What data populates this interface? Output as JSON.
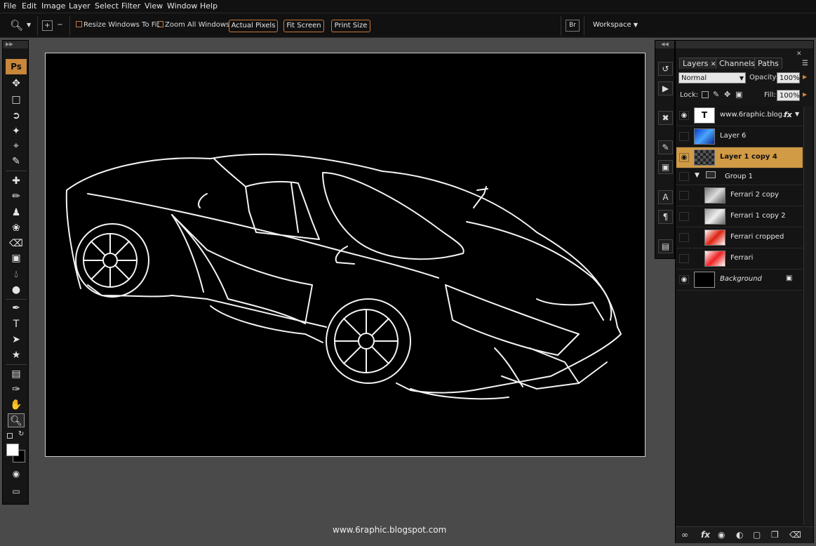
{
  "menu": [
    "File",
    "Edit",
    "Image",
    "Layer",
    "Select",
    "Filter",
    "View",
    "Window",
    "Help"
  ],
  "options": {
    "resize_windows_label": "Resize Windows To Fit",
    "zoom_all_label": "Zoom All Windows",
    "actual_pixels": "Actual Pixels",
    "fit_screen": "Fit Screen",
    "print_size": "Print Size",
    "workspace": "Workspace"
  },
  "toolbar": {
    "ps_logo": "Ps"
  },
  "canvas": {
    "footer_text": "www.6raphic.blogspot.com"
  },
  "panel": {
    "tabs": [
      "Layers",
      "Channels",
      "Paths"
    ],
    "blend_mode": "Normal",
    "opacity_label": "Opacity:",
    "opacity_value": "100%",
    "lock_label": "Lock:",
    "fill_label": "Fill:",
    "fill_value": "100%",
    "layers": [
      {
        "name": "www.6raphic.blog...",
        "type": "text",
        "visible": true
      },
      {
        "name": "Layer 6",
        "type": "image",
        "visible": false
      },
      {
        "name": "Layer 1 copy 4",
        "type": "image",
        "visible": true,
        "selected": true
      },
      {
        "name": "Group 1",
        "type": "group",
        "visible": false
      },
      {
        "name": "Ferrari 2 copy",
        "type": "image",
        "visible": false
      },
      {
        "name": "Ferrari 1 copy 2",
        "type": "image",
        "visible": false
      },
      {
        "name": "Ferrari cropped",
        "type": "image",
        "visible": false
      },
      {
        "name": "Ferrari",
        "type": "image",
        "visible": false
      },
      {
        "name": "Background",
        "type": "background",
        "visible": true
      }
    ]
  },
  "colors": {
    "accent": "#d19a45",
    "button_border": "#c9763a"
  }
}
